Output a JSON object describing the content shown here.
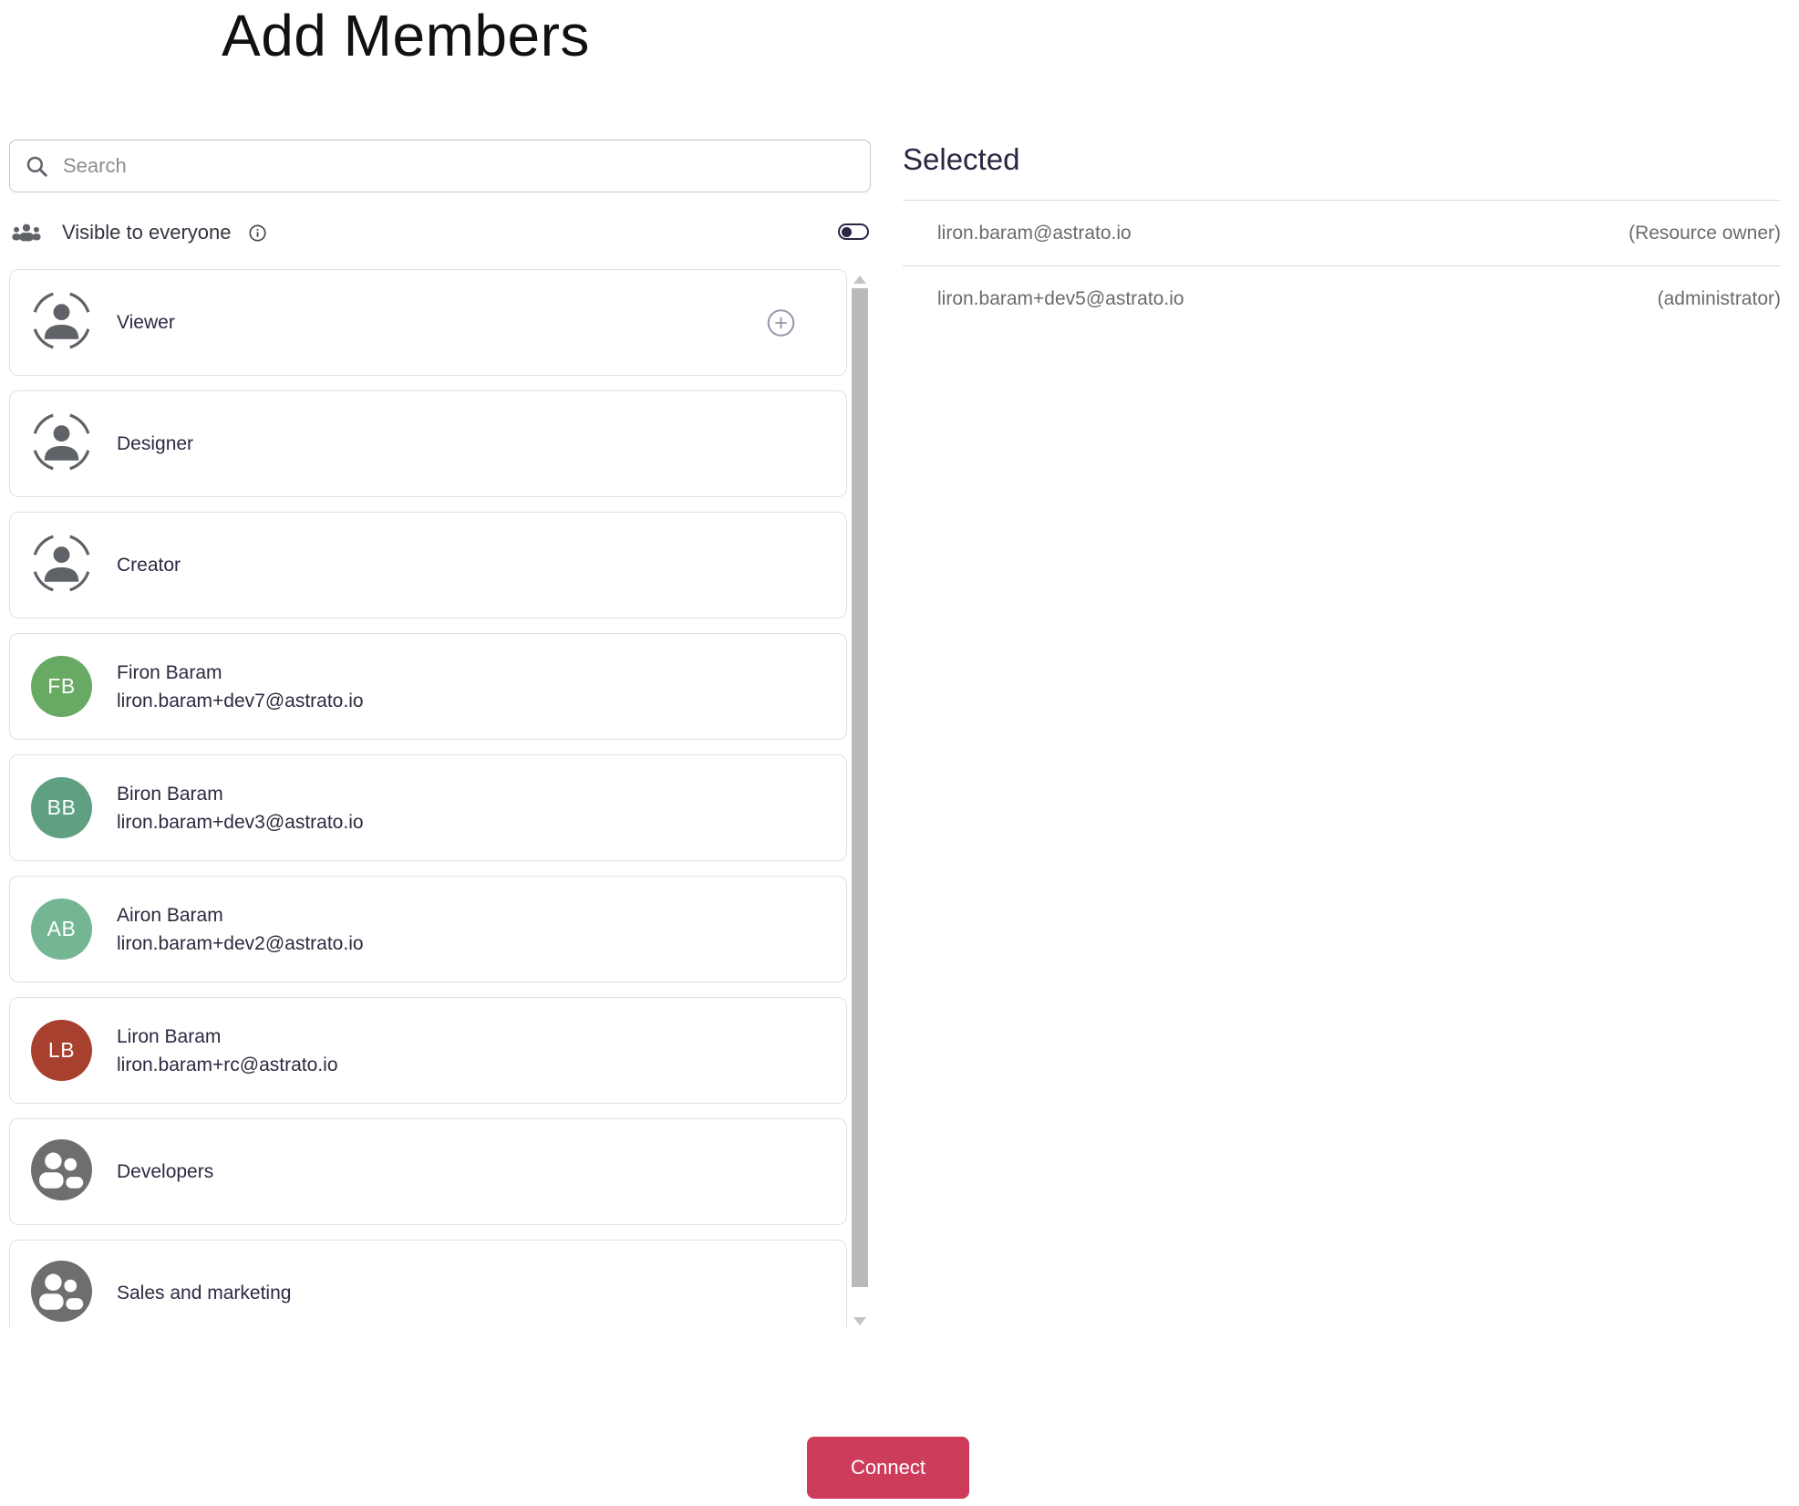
{
  "page": {
    "title": "Add Members"
  },
  "search": {
    "placeholder": "Search"
  },
  "visibility": {
    "label": "Visible to everyone",
    "toggle_on": false
  },
  "list": {
    "items": [
      {
        "type": "role",
        "label": "Viewer",
        "has_add_button": true
      },
      {
        "type": "role",
        "label": "Designer"
      },
      {
        "type": "role",
        "label": "Creator"
      },
      {
        "type": "user",
        "initials": "FB",
        "name": "Firon Baram",
        "email": "liron.baram+dev7@astrato.io",
        "avatar_color": "#68a963"
      },
      {
        "type": "user",
        "initials": "BB",
        "name": "Biron Baram",
        "email": "liron.baram+dev3@astrato.io",
        "avatar_color": "#5fa083"
      },
      {
        "type": "user",
        "initials": "AB",
        "name": "Airon Baram",
        "email": "liron.baram+dev2@astrato.io",
        "avatar_color": "#74b594"
      },
      {
        "type": "user",
        "initials": "LB",
        "name": "Liron Baram",
        "email": "liron.baram+rc@astrato.io",
        "avatar_color": "#a7402f"
      },
      {
        "type": "group",
        "label": "Developers"
      },
      {
        "type": "group",
        "label": "Sales and marketing"
      }
    ]
  },
  "selected": {
    "heading": "Selected",
    "members": [
      {
        "email": "liron.baram@astrato.io",
        "role": "(Resource owner)"
      },
      {
        "email": "liron.baram+dev5@astrato.io",
        "role": "(administrator)"
      }
    ]
  },
  "footer": {
    "connect_label": "Connect"
  },
  "colors": {
    "accent": "#ce3c5c",
    "toggle": "#272741",
    "group_avatar": "#6e6e6e",
    "icon_gray": "#5f6368"
  }
}
